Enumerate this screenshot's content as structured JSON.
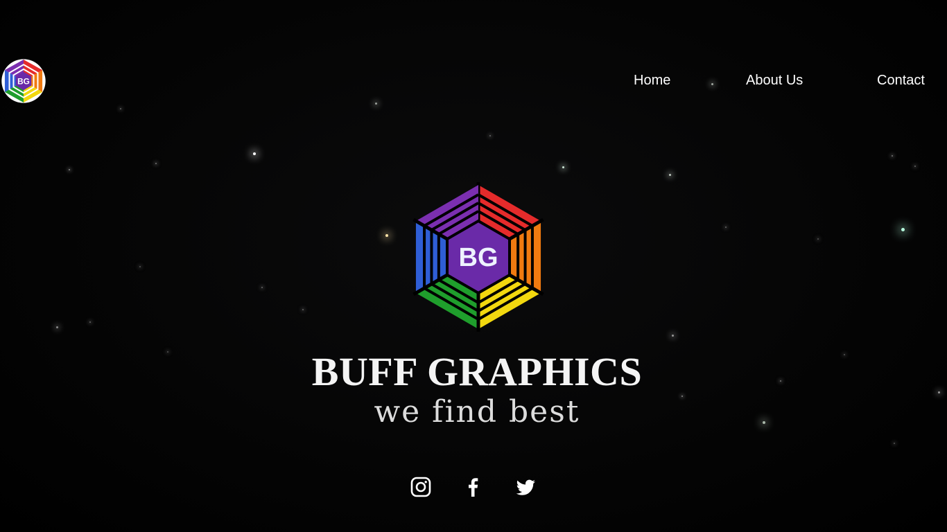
{
  "brand": {
    "name": "BUFF GRAPHICS",
    "tagline": "we find best",
    "logo_initials": "BG",
    "logo_colors": {
      "purple": "#7b2fb0",
      "red": "#e52b2b",
      "orange": "#f07a10",
      "yellow": "#f2d80f",
      "green": "#1f9e2c",
      "blue": "#2f5ed6",
      "core": "#6a2aa8"
    }
  },
  "nav": {
    "items": [
      {
        "label": "Home"
      },
      {
        "label": "About Us"
      },
      {
        "label": "Contact"
      }
    ]
  },
  "social": [
    {
      "icon": "instagram-icon"
    },
    {
      "icon": "facebook-icon"
    },
    {
      "icon": "twitter-icon"
    }
  ],
  "colors": {
    "background": "#000000",
    "text": "#ffffff"
  }
}
